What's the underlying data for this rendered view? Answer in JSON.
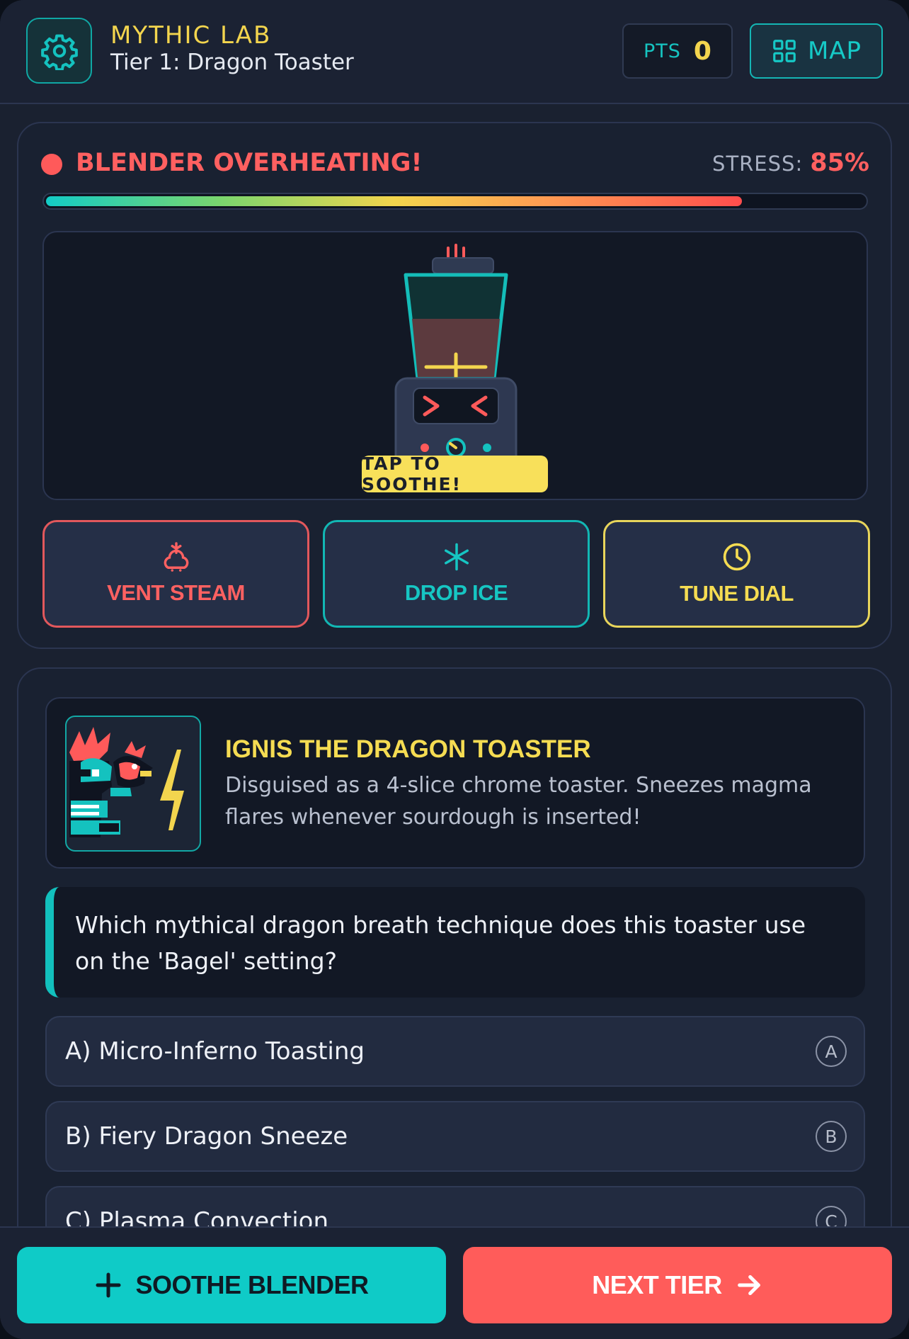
{
  "header": {
    "title": "MYTHIC LAB",
    "subtitle": "Tier 1: Dragon Toaster",
    "points_label": "PTS",
    "points_value": "0",
    "map_label": "MAP",
    "icons": {
      "settings": "gear-icon",
      "map": "grid-icon"
    }
  },
  "status": {
    "alert": "BLENDER OVERHEATING!",
    "stress_label": "STRESS:",
    "stress_value": "85%",
    "stress_fraction": 0.85
  },
  "stage": {
    "hint": "TAP TO SOOTHE!"
  },
  "tools": [
    {
      "label": "VENT STEAM",
      "icon": "steam-icon",
      "color": "#ff6161"
    },
    {
      "label": "DROP ICE",
      "icon": "snowflake-icon",
      "color": "#16c6c3"
    },
    {
      "label": "TUNE DIAL",
      "icon": "clock-icon",
      "color": "#f5dc52"
    }
  ],
  "creature": {
    "name": "IGNIS THE DRAGON TOASTER",
    "description": "Disguised as a 4-slice chrome toaster. Sneezes magma flares whenever sourdough is inserted!"
  },
  "question": "Which mythical dragon breath technique does this toaster use on the 'Bagel' setting?",
  "answers": [
    {
      "text": "A) Micro-Inferno Toasting",
      "key": "A"
    },
    {
      "text": "B) Fiery Dragon Sneeze",
      "key": "B"
    },
    {
      "text": "C) Plasma Convection",
      "key": "C"
    }
  ],
  "actions": {
    "soothe_label": "SOOTHE BLENDER",
    "next_label": "NEXT TIER"
  },
  "colors": {
    "accent_teal": "#0fcbc7",
    "accent_yellow": "#f5dc52",
    "accent_red": "#ff5c5a",
    "background": "#1a2130"
  }
}
